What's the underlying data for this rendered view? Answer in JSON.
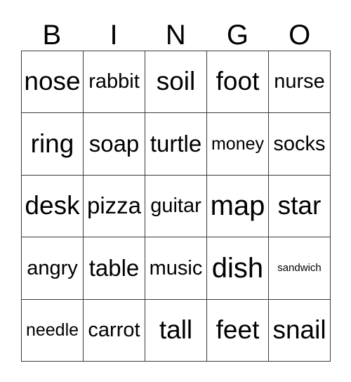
{
  "card": {
    "headers": [
      "B",
      "I",
      "N",
      "G",
      "O"
    ],
    "rows": [
      [
        {
          "text": "nose",
          "size": "fs-xl"
        },
        {
          "text": "rabbit",
          "size": "fs-m"
        },
        {
          "text": "soil",
          "size": "fs-xl"
        },
        {
          "text": "foot",
          "size": "fs-xl"
        },
        {
          "text": "nurse",
          "size": "fs-m"
        }
      ],
      [
        {
          "text": "ring",
          "size": "fs-xl"
        },
        {
          "text": "soap",
          "size": "fs-l"
        },
        {
          "text": "turtle",
          "size": "fs-l"
        },
        {
          "text": "money",
          "size": "fs-s"
        },
        {
          "text": "socks",
          "size": "fs-m"
        }
      ],
      [
        {
          "text": "desk",
          "size": "fs-xl"
        },
        {
          "text": "pizza",
          "size": "fs-l"
        },
        {
          "text": "guitar",
          "size": "fs-m"
        },
        {
          "text": "map",
          "size": "fs-xxl"
        },
        {
          "text": "star",
          "size": "fs-xl"
        }
      ],
      [
        {
          "text": "angry",
          "size": "fs-m"
        },
        {
          "text": "table",
          "size": "fs-l"
        },
        {
          "text": "music",
          "size": "fs-m"
        },
        {
          "text": "dish",
          "size": "fs-xxl"
        },
        {
          "text": "sandwich",
          "size": "fs-xxs"
        }
      ],
      [
        {
          "text": "needle",
          "size": "fs-s"
        },
        {
          "text": "carrot",
          "size": "fs-m"
        },
        {
          "text": "tall",
          "size": "fs-xl"
        },
        {
          "text": "feet",
          "size": "fs-xl"
        },
        {
          "text": "snail",
          "size": "fs-xl"
        }
      ]
    ]
  }
}
